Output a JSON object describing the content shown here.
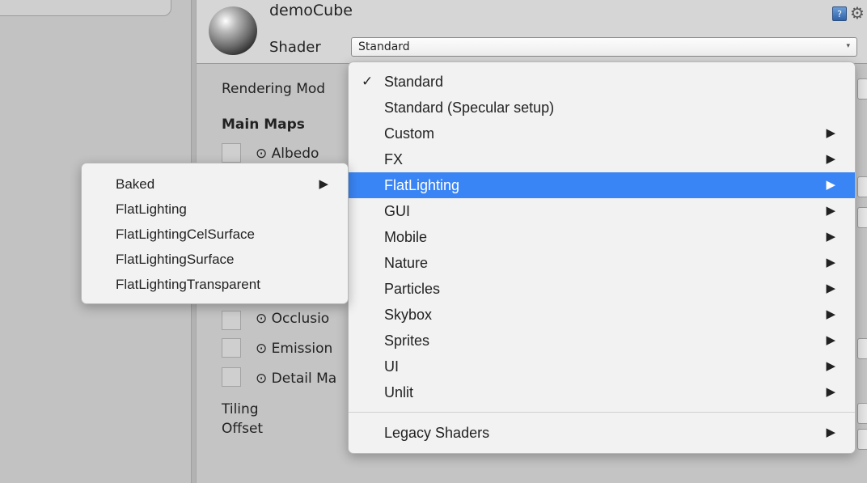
{
  "inspector": {
    "object_name": "demoCube",
    "shader_label": "Shader",
    "shader_value": "Standard",
    "properties": {
      "rendering_mode": "Rendering Mod",
      "main_maps": "Main Maps",
      "albedo": "⊙ Albedo",
      "occlusion": "⊙ Occlusio",
      "emission": "⊙ Emission",
      "detail_mask": "⊙ Detail Ma",
      "tiling": "Tiling",
      "offset": "Offset"
    }
  },
  "shader_menu": {
    "items": [
      {
        "label": "Standard",
        "checked": true,
        "submenu": false
      },
      {
        "label": "Standard (Specular setup)",
        "checked": false,
        "submenu": false
      },
      {
        "label": "Custom",
        "checked": false,
        "submenu": true
      },
      {
        "label": "FX",
        "checked": false,
        "submenu": true
      },
      {
        "label": "FlatLighting",
        "checked": false,
        "submenu": true,
        "highlighted": true
      },
      {
        "label": "GUI",
        "checked": false,
        "submenu": true
      },
      {
        "label": "Mobile",
        "checked": false,
        "submenu": true
      },
      {
        "label": "Nature",
        "checked": false,
        "submenu": true
      },
      {
        "label": "Particles",
        "checked": false,
        "submenu": true
      },
      {
        "label": "Skybox",
        "checked": false,
        "submenu": true
      },
      {
        "label": "Sprites",
        "checked": false,
        "submenu": true
      },
      {
        "label": "UI",
        "checked": false,
        "submenu": true
      },
      {
        "label": "Unlit",
        "checked": false,
        "submenu": true
      }
    ],
    "footer_item": {
      "label": "Legacy Shaders",
      "submenu": true
    }
  },
  "flatlighting_submenu": {
    "items": [
      {
        "label": "Baked",
        "submenu": true
      },
      {
        "label": "FlatLighting",
        "submenu": false
      },
      {
        "label": "FlatLightingCelSurface",
        "submenu": false
      },
      {
        "label": "FlatLightingSurface",
        "submenu": false
      },
      {
        "label": "FlatLightingTransparent",
        "submenu": false
      }
    ]
  },
  "glyphs": {
    "check": "✓",
    "submenu_arrow": "▶",
    "dropdown_arrow": "▾",
    "gear": "⚙",
    "help": "?"
  },
  "colors": {
    "highlight": "#3a85f5",
    "menu_bg": "#f2f2f2",
    "inspector_bg": "#c4c4c4"
  }
}
